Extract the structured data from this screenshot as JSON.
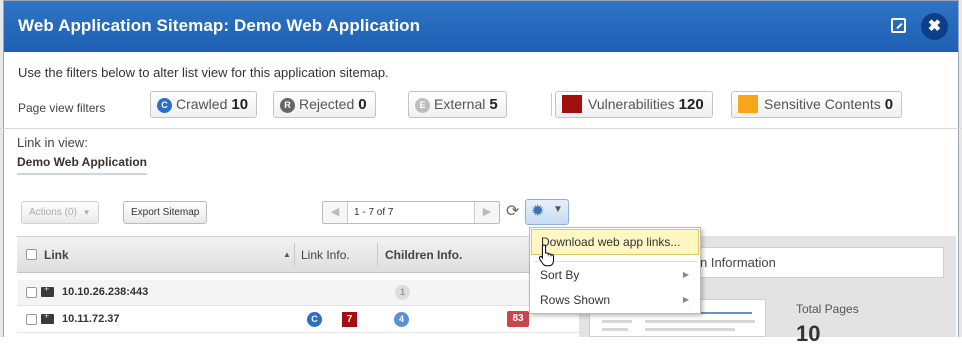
{
  "window": {
    "title": "Web Application Sitemap: Demo Web Application",
    "popout_icon": "popout-icon",
    "close_icon": "close-icon",
    "close_glyph": "✖"
  },
  "intro_text": "Use the filters below to alter list view for this application sitemap.",
  "filters": {
    "label": "Page view filters",
    "items": [
      {
        "badge": "C",
        "label": "Crawled",
        "count": "10",
        "color": "#2a6fc9"
      },
      {
        "badge": "R",
        "label": "Rejected",
        "count": "0",
        "color": "#666666"
      },
      {
        "badge": "E",
        "label": "External",
        "count": "5",
        "color": "#bdbdbd"
      },
      {
        "label": "Vulnerabilities",
        "count": "120",
        "color": "#a30f0f"
      },
      {
        "label": "Sensitive Contents",
        "count": "0",
        "color": "#f7a51b"
      }
    ]
  },
  "link_in_view": {
    "label": "Link in view:",
    "value": "Demo Web Application"
  },
  "toolbar": {
    "actions_label": "Actions (0)",
    "actions_caret": "▼",
    "export_label": "Export Sitemap",
    "pager_prev": "◀",
    "pager_next": "▶",
    "pager_value": "1 - 7 of 7",
    "refresh_glyph": "⟳",
    "gear_glyph": "✹",
    "gear_caret": "▼"
  },
  "table": {
    "columns": {
      "link": "Link",
      "sort_glyph": "▲",
      "link_info": "Link Info.",
      "children_info": "Children Info."
    },
    "rows": [
      {
        "link": "10.10.26.238:443",
        "link_info": [],
        "children_badge": "1",
        "children_count": ""
      },
      {
        "link": "10.11.72.37",
        "link_info": [
          {
            "text": "C",
            "type": "crawled"
          },
          {
            "text": "7",
            "type": "vuln"
          }
        ],
        "children_badge": "4",
        "children_count": "83"
      }
    ]
  },
  "side_panel": {
    "title": "n Information",
    "total_pages_label": "Total Pages",
    "total_pages_value": "10"
  },
  "menu": {
    "items": [
      {
        "label": "Download web app links...",
        "submenu": false
      },
      {
        "label": "Sort By",
        "submenu": true
      },
      {
        "label": "Rows Shown",
        "submenu": true
      }
    ],
    "submenu_glyph": "▶"
  }
}
